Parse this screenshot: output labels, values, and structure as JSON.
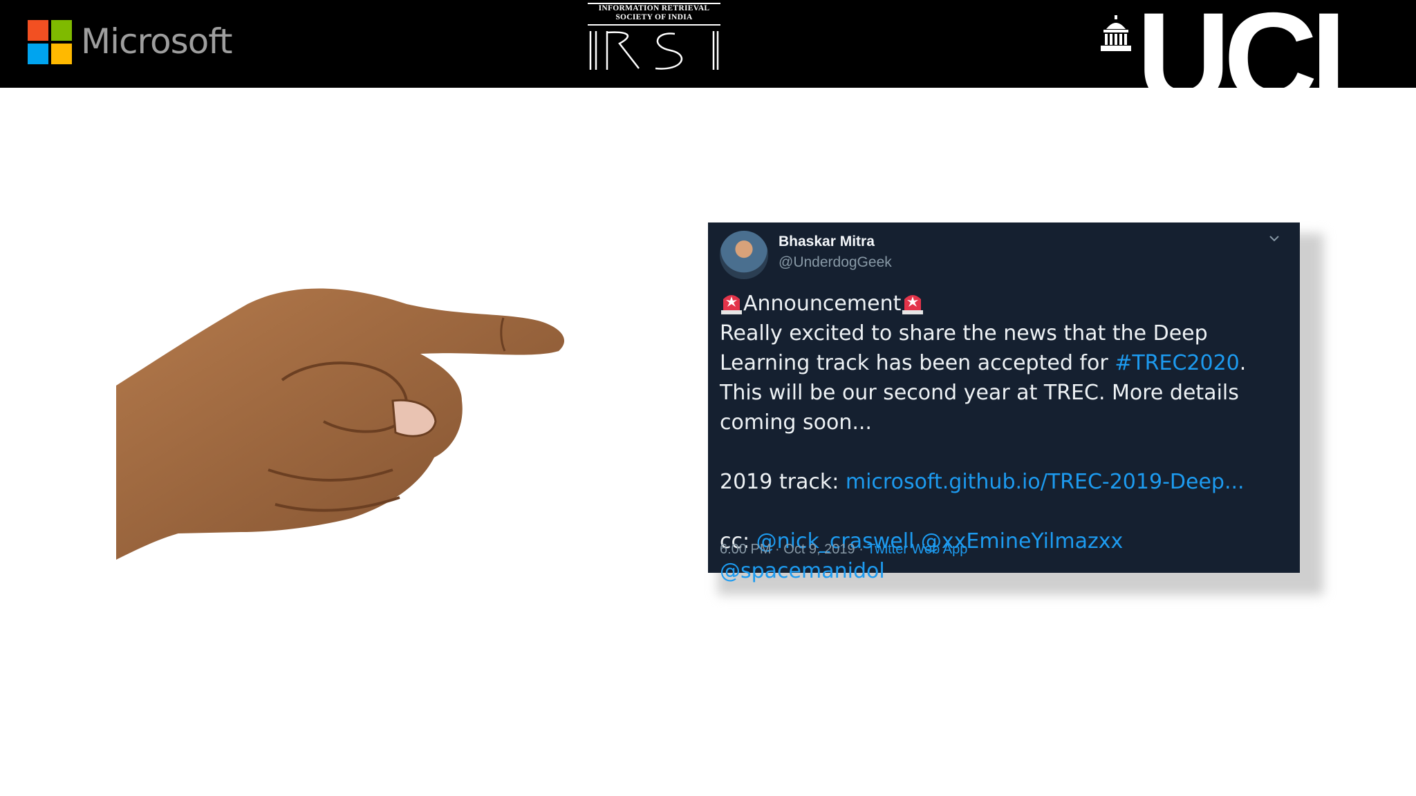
{
  "header": {
    "microsoft_word": "Microsoft",
    "irsi_caption_line1": "INFORMATION RETRIEVAL",
    "irsi_caption_line2": "SOCIETY OF INDIA",
    "irsi_mark": "IRSI",
    "ucl_word": "UCL",
    "colors": {
      "bar": "#000000",
      "ms_red": "#f25022",
      "ms_green": "#7fba00",
      "ms_blue": "#00a4ef",
      "ms_yellow": "#ffb900"
    }
  },
  "tweet": {
    "author_name": "Bhaskar Mitra",
    "author_handle": "@UnderdogGeek",
    "announcement": "Announcement",
    "body_part1": "Really excited to share the news that the Deep Learning track has been accepted for ",
    "hashtag": "#TREC2020",
    "body_part2": ". This will be our second year at TREC. More details coming soon...",
    "track_label": "2019 track: ",
    "track_link": "microsoft.github.io/TREC-2019-Deep...",
    "cc_label": "cc: ",
    "mentions": [
      "@nick_craswell",
      "@xxEmineYilmazxx",
      "@spacemanidol"
    ],
    "timestamp": "6:00 PM · Oct 9, 2019 · ",
    "source_app": "Twitter Web App",
    "colors": {
      "background": "#152030",
      "link": "#1d9bf0",
      "muted": "#8899a6"
    }
  }
}
